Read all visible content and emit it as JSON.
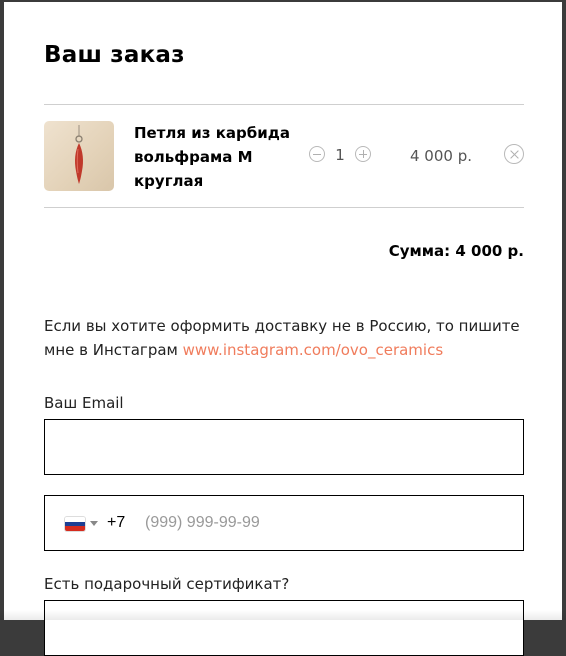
{
  "order": {
    "title": "Ваш заказ",
    "items": [
      {
        "name": "Петля из карбида вольфрама М круглая",
        "quantity": "1",
        "price": "4 000 р."
      }
    ],
    "sum_label": "Сумма: 4 000 р."
  },
  "note": {
    "text": "Если вы хотите оформить доставку не в Россию, то пишите мне в Инстаграм ",
    "link_text": "www.instagram.com/ovo_ceramics"
  },
  "form": {
    "email_label": "Ваш Email",
    "email_value": "",
    "phone_country": "RU",
    "phone_prefix": "+7",
    "phone_placeholder": "(999) 999-99-99",
    "gift_label": "Есть подарочный сертификат?"
  },
  "colors": {
    "link": "#f07c5c",
    "field_border": "#000000",
    "divider": "#cfcfcf"
  }
}
